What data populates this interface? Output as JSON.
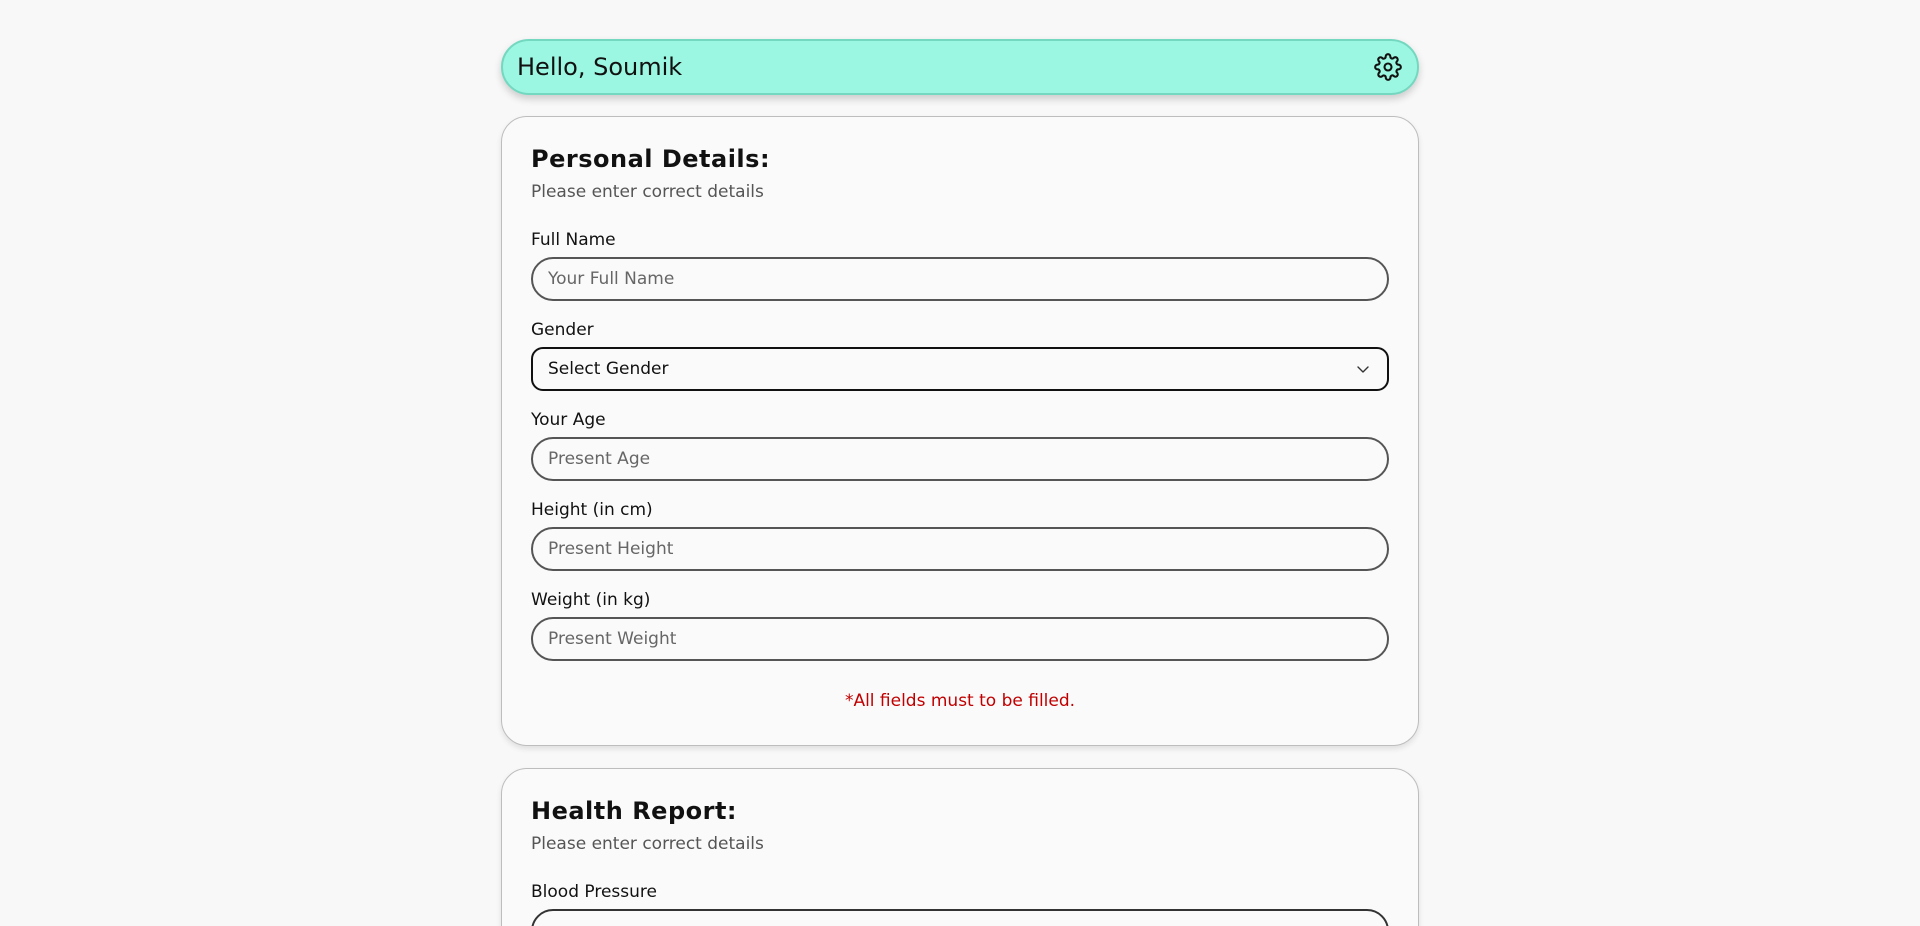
{
  "header": {
    "greeting": "Hello, Soumik",
    "settings_icon": "gear-icon"
  },
  "personal_details": {
    "title": "Personal Details:",
    "subtitle": "Please enter correct details",
    "fields": {
      "full_name": {
        "label": "Full Name",
        "placeholder": "Your Full Name",
        "value": ""
      },
      "gender": {
        "label": "Gender",
        "selected": "Select Gender"
      },
      "age": {
        "label": "Your Age",
        "placeholder": "Present Age",
        "value": ""
      },
      "height": {
        "label": "Height (in cm)",
        "placeholder": "Present Height",
        "value": ""
      },
      "weight": {
        "label": "Weight (in kg)",
        "placeholder": "Present Weight",
        "value": ""
      }
    },
    "error": "*All fields must to be filled."
  },
  "health_report": {
    "title": "Health Report:",
    "subtitle": "Please enter correct details",
    "fields": {
      "blood_pressure": {
        "label": "Blood Pressure"
      }
    }
  },
  "colors": {
    "header_bg": "#9bf7e1",
    "error": "#c00000"
  }
}
